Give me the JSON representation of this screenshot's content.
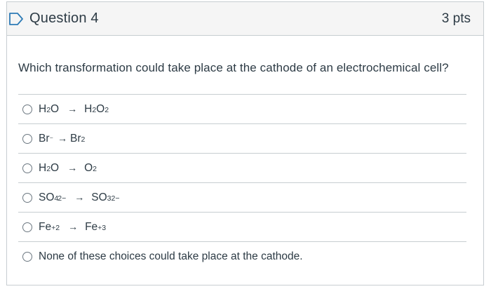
{
  "question": {
    "title": "Question 4",
    "points": "3 pts",
    "prompt": "Which transformation could take place at the cathode of an electrochemical cell?"
  },
  "answers": [
    {
      "reactant": "H",
      "r_sub": "2",
      "r_rest": "O",
      "product": "H",
      "p_sub": "2",
      "p_rest": "O",
      "p_sub2": "2"
    },
    {
      "reactant": "Br",
      "r_sup": "⁻",
      "product": "Br",
      "p_sub": "2"
    },
    {
      "reactant": "H",
      "r_sub": "2",
      "r_rest": "O",
      "product": "O",
      "p_sub": "2"
    },
    {
      "reactant": "SO",
      "r_sub": "4",
      "r_sup": "2−",
      "product": "SO",
      "p_sub": "3",
      "p_sup": "2−"
    },
    {
      "reactant": "Fe",
      "r_sup": "+2",
      "product": "Fe",
      "p_sup": "+3"
    },
    {
      "text": "None of these choices could take place at the cathode."
    }
  ],
  "arrow": "→"
}
